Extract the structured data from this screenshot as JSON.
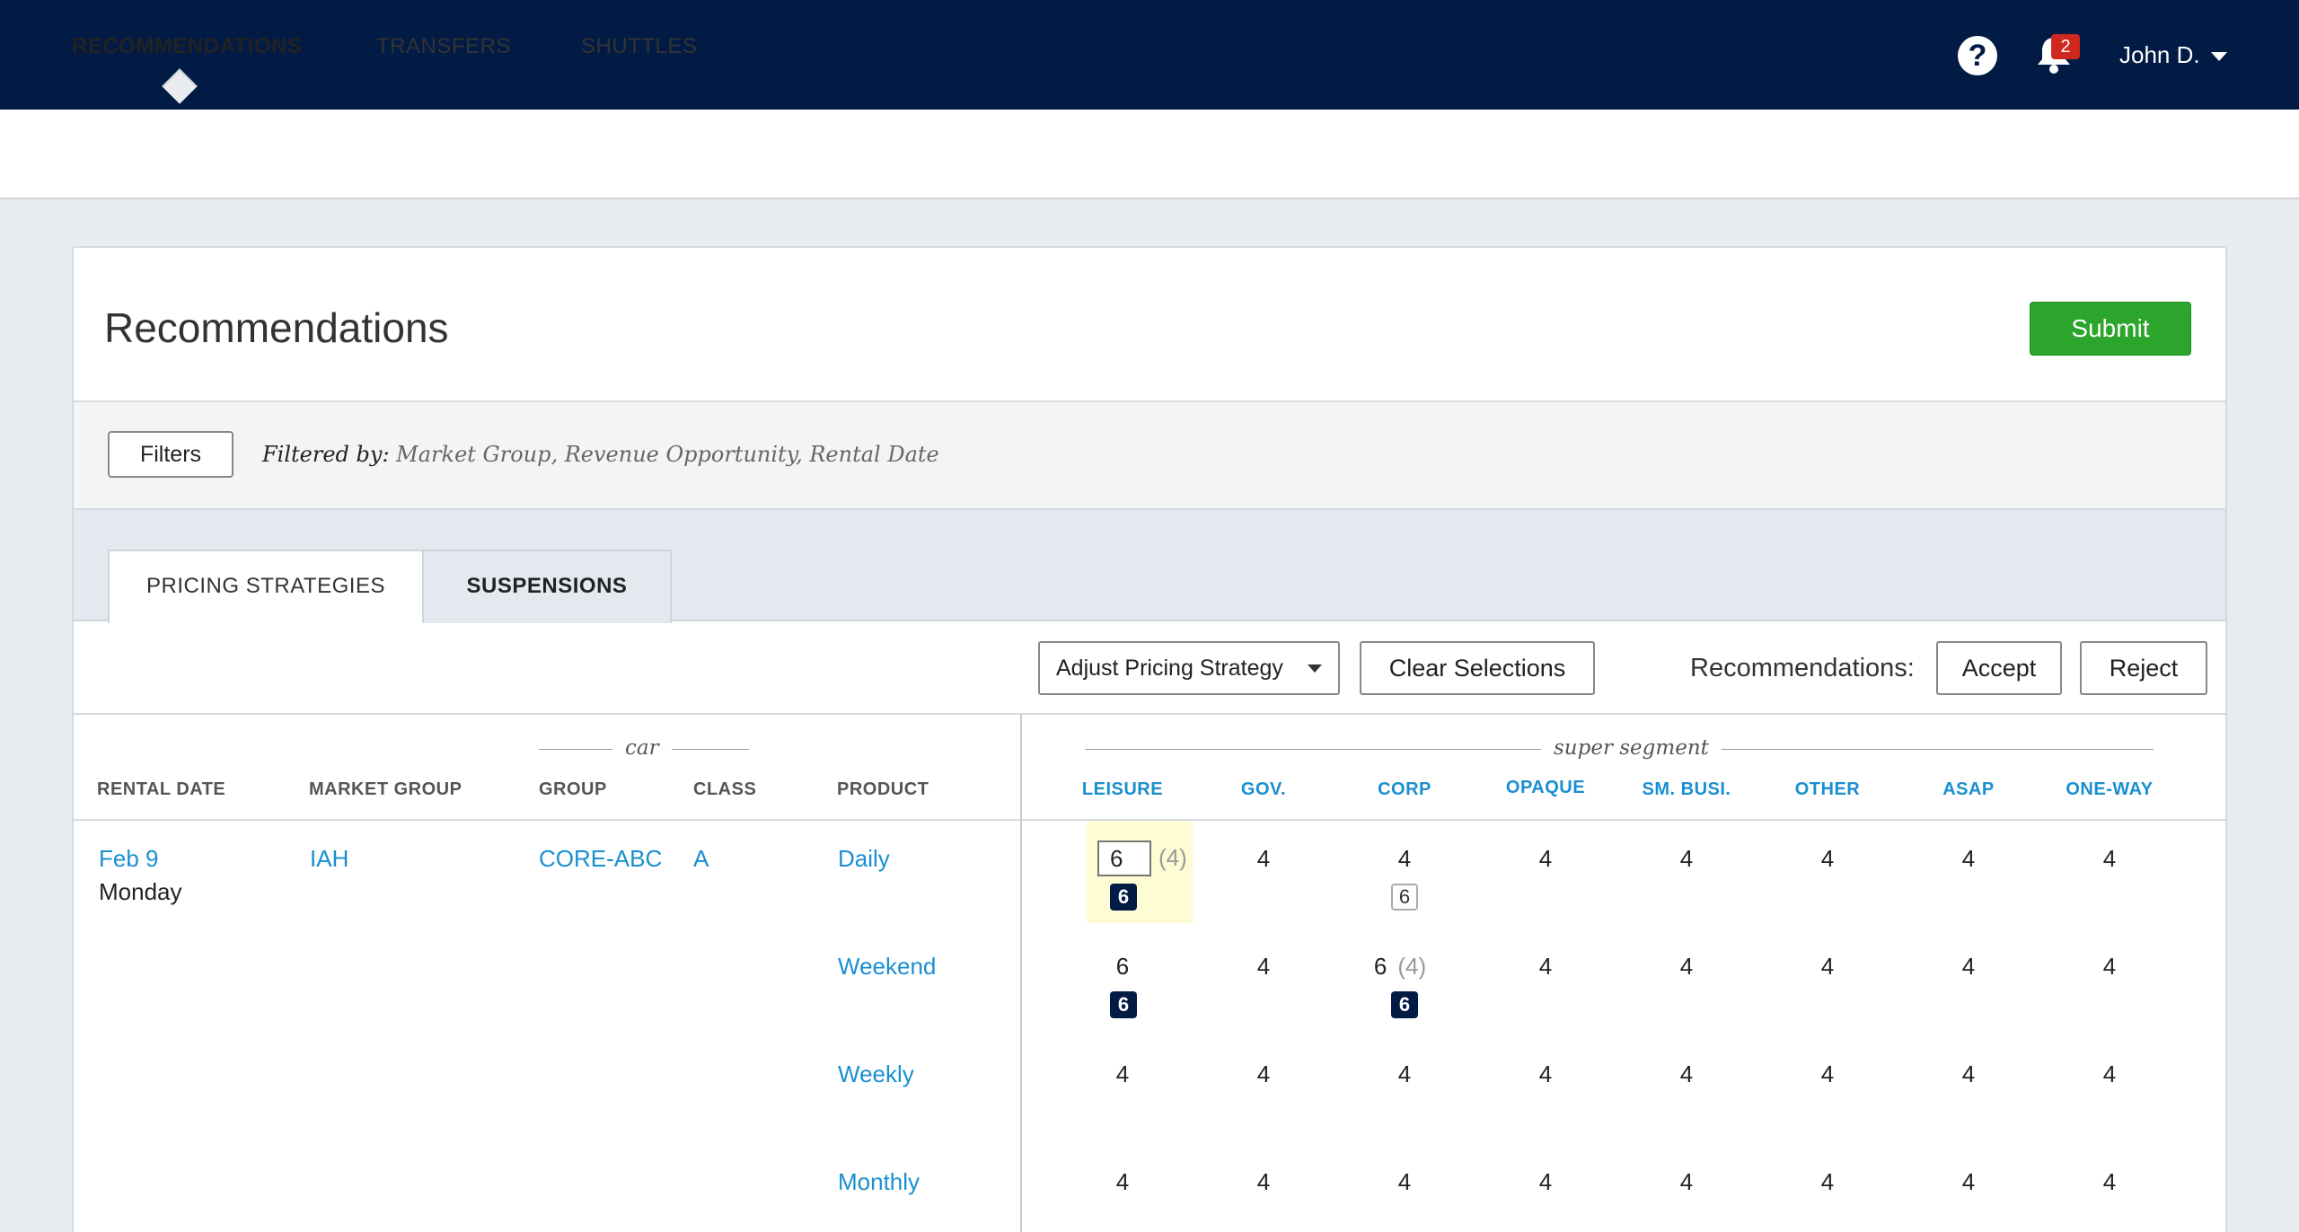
{
  "header": {
    "notifications_count": "2",
    "user_name": "John D."
  },
  "nav": {
    "tabs": [
      "RECOMMENDATIONS",
      "TRANSFERS",
      "SHUTTLES"
    ],
    "active": "RECOMMENDATIONS"
  },
  "page": {
    "title": "Recommendations",
    "submit_label": "Submit"
  },
  "filters": {
    "button_label": "Filters",
    "filtered_by_label": "Filtered by:",
    "filtered_by_value": "Market Group, Revenue Opportunity, Rental Date"
  },
  "tabs": {
    "pricing": "PRICING STRATEGIES",
    "suspensions": "SUSPENSIONS"
  },
  "toolbar": {
    "strategy_select": "Adjust Pricing Strategy",
    "clear_label": "Clear Selections",
    "recommendations_label": "Recommendations:",
    "accept_label": "Accept",
    "reject_label": "Reject"
  },
  "table": {
    "car_group_label": "car",
    "super_segment_label": "super segment",
    "columns": {
      "rental_date": "RENTAL DATE",
      "market_group": "MARKET GROUP",
      "group": "GROUP",
      "class": "CLASS",
      "product": "PRODUCT"
    },
    "segments": [
      "LEISURE",
      "GOV.",
      "CORP",
      "OPAQUE",
      "SM. BUSI.",
      "OTHER",
      "ASAP",
      "ONE-WAY"
    ],
    "row": {
      "date": "Feb 9",
      "weekday": "Monday",
      "market_group": "IAH",
      "group": "CORE-ABC",
      "class": "A"
    },
    "products": [
      {
        "name": "Daily",
        "values": [
          "6",
          "4",
          "4",
          "4",
          "4",
          "4",
          "4",
          "4"
        ]
      },
      {
        "name": "Weekend",
        "values": [
          "6",
          "4",
          "6",
          "4",
          "4",
          "4",
          "4",
          "4"
        ]
      },
      {
        "name": "Weekly",
        "values": [
          "4",
          "4",
          "4",
          "4",
          "4",
          "4",
          "4",
          "4"
        ]
      },
      {
        "name": "Monthly",
        "values": [
          "4",
          "4",
          "4",
          "4",
          "4",
          "4",
          "4",
          "4"
        ]
      }
    ],
    "editing": {
      "value": "6",
      "previous": "(4)"
    },
    "weekend_corp_previous": "(4)",
    "badges": {
      "daily_leisure": "6",
      "daily_corp": "6",
      "weekend_leisure": "6",
      "weekend_corp": "6"
    }
  },
  "colors": {
    "topbar": "#021b45",
    "link": "#1a8fd0",
    "submit": "#2ba52b",
    "highlight": "#fdfcd2"
  }
}
